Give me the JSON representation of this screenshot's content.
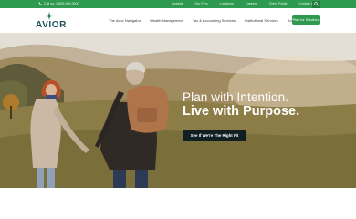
{
  "topbar": {
    "phone": "Call us: 1-800-000-0000",
    "links": [
      "Insights",
      "Our Firm",
      "Locations",
      "Careers",
      "Client Portal",
      "Contact Us"
    ]
  },
  "nav": {
    "logo_text": "AVIOR",
    "items": [
      "The Avior Navigator",
      "Wealth Management",
      "Tax & Accounting Services",
      "Institutional Services",
      "Solutions For"
    ],
    "cta": "Plan for Solutions"
  },
  "hero": {
    "headline_line1": "Plan with Intention.",
    "headline_line2": "Live with Purpose.",
    "button": "See If We're The Right Fit"
  },
  "colors": {
    "brand_green": "#2e9a4f",
    "dark_button": "#0f1f22",
    "logo_navy": "#1d4f5c"
  }
}
